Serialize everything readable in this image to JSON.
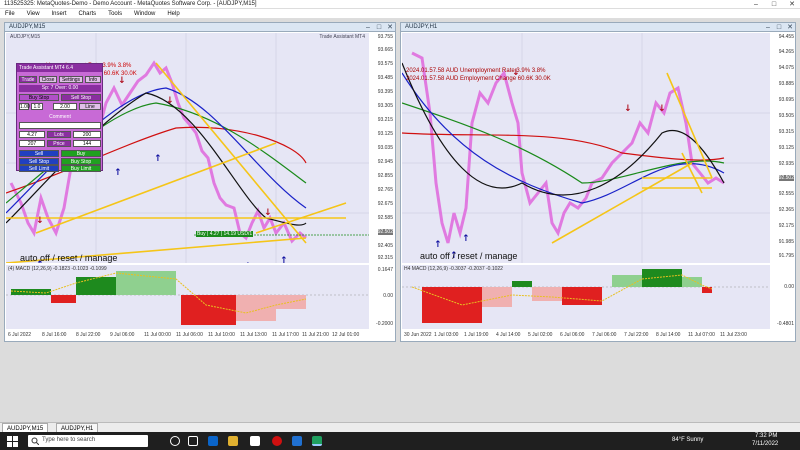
{
  "window": {
    "title": "113525325: MetaQuotes-Demo - Demo Account - MetaQuotes Software Corp. - [AUDJPY,M15]",
    "minimize": "–",
    "maximize": "□",
    "close": "✕"
  },
  "menu": [
    "File",
    "View",
    "Insert",
    "Charts",
    "Tools",
    "Window",
    "Help"
  ],
  "left_chart": {
    "title": "AUDJPY,M15",
    "subtitle": "AUDJPY,M15",
    "ea_label": "Trade Assistant MT4",
    "y_ticks": [
      "93.755",
      "93.665",
      "93.575",
      "93.485",
      "93.395",
      "93.305",
      "93.215",
      "93.125",
      "93.035",
      "92.945",
      "92.855",
      "92.765",
      "92.675",
      "92.585",
      "92.495",
      "92.405",
      "92.315"
    ],
    "price_tag": "92.502",
    "x_ticks": [
      "6 Jul 2022",
      "8 Jul 16:00",
      "8 Jul 22:00",
      "9 Jul 06:00",
      "11 Jul 00:00",
      "11 Jul 06:00",
      "11 Jul 10:00",
      "11 Jul 13:00",
      "11 Jul 17:00",
      "11 Jul 21:00",
      "12 Jul 01:00"
    ],
    "info_lines": [
      "Unemployment Rate   3.9%  3.8%",
      "Employment Change   60.6K  30.0K"
    ],
    "buy_label": "Buy | 4.27 | 14.19 USD/1",
    "auto_text": "auto off / reset / manage",
    "macd_label": "(4) MACD (12,26,9) -0.1823  -0.1023  -0.1099",
    "macd_ticks": [
      "0.1647",
      "0.00",
      "-0.2000"
    ]
  },
  "trade_assistant": {
    "header": "Trade Assistant MT4 6.4",
    "row1": [
      "Trade",
      "Close",
      "Settings",
      "Info"
    ],
    "sl": "Sp: 7  Over: 0.00",
    "row3": [
      "Buy Stop",
      "Sell Stop"
    ],
    "row4": [
      "1.00",
      "1.0",
      "2.00",
      "Line"
    ],
    "comment": "Comment",
    "fields": [
      "4.27",
      "Lots",
      "200",
      "207",
      "Price",
      "144"
    ],
    "actions": [
      "Sell",
      "Buy",
      "Sell Stop",
      "Buy Stop",
      "Sell Limit",
      "Buy Limit"
    ]
  },
  "right_chart": {
    "title": "AUDJPY,H1",
    "y_ticks": [
      "94.455",
      "94.265",
      "94.075",
      "93.885",
      "93.695",
      "93.505",
      "93.315",
      "93.125",
      "92.935",
      "92.745",
      "92.555",
      "92.365",
      "92.175",
      "91.985",
      "91.795"
    ],
    "price_tag": "92.502",
    "x_ticks": [
      "30 Jun 2022",
      "1 Jul 03:00",
      "1 Jul 19:00",
      "4 Jul 14:00",
      "5 Jul 02:00",
      "6 Jul 06:00",
      "7 Jul 06:00",
      "7 Jul 22:00",
      "8 Jul 14:00",
      "11 Jul 07:00",
      "11 Jul 23:00"
    ],
    "info_lines": [
      "2024.01.57.58  AUD Unemployment Rate   3.9%  3.8%",
      "2024.01.57.58  AUD Employment Change   60.6K  30.0K"
    ],
    "auto_text": "auto off / reset / manage",
    "macd_label": "H4 MACD (12,26,9) -0.3037  -0.2037  -0.1022",
    "macd_ticks": [
      "0.00",
      "-0.4801"
    ]
  },
  "tabs": [
    "AUDJPY,M15",
    "AUDJPY,H1"
  ],
  "taskbar": {
    "search_placeholder": "Type here to search",
    "weather": "84°F  Sunny",
    "time": "7:32 PM",
    "date": "7/11/2022"
  },
  "colors": {
    "chart_bg": "#e6e6f5",
    "candle_pink": "#e07ae0",
    "ema_red": "#d01010",
    "ema_green": "#1a8a1a",
    "ema_blue": "#1a22c8",
    "ema_black": "#111111",
    "trendline_yellow": "#f5c518",
    "macd_up": "#1e8a1e",
    "macd_down": "#e02020"
  }
}
